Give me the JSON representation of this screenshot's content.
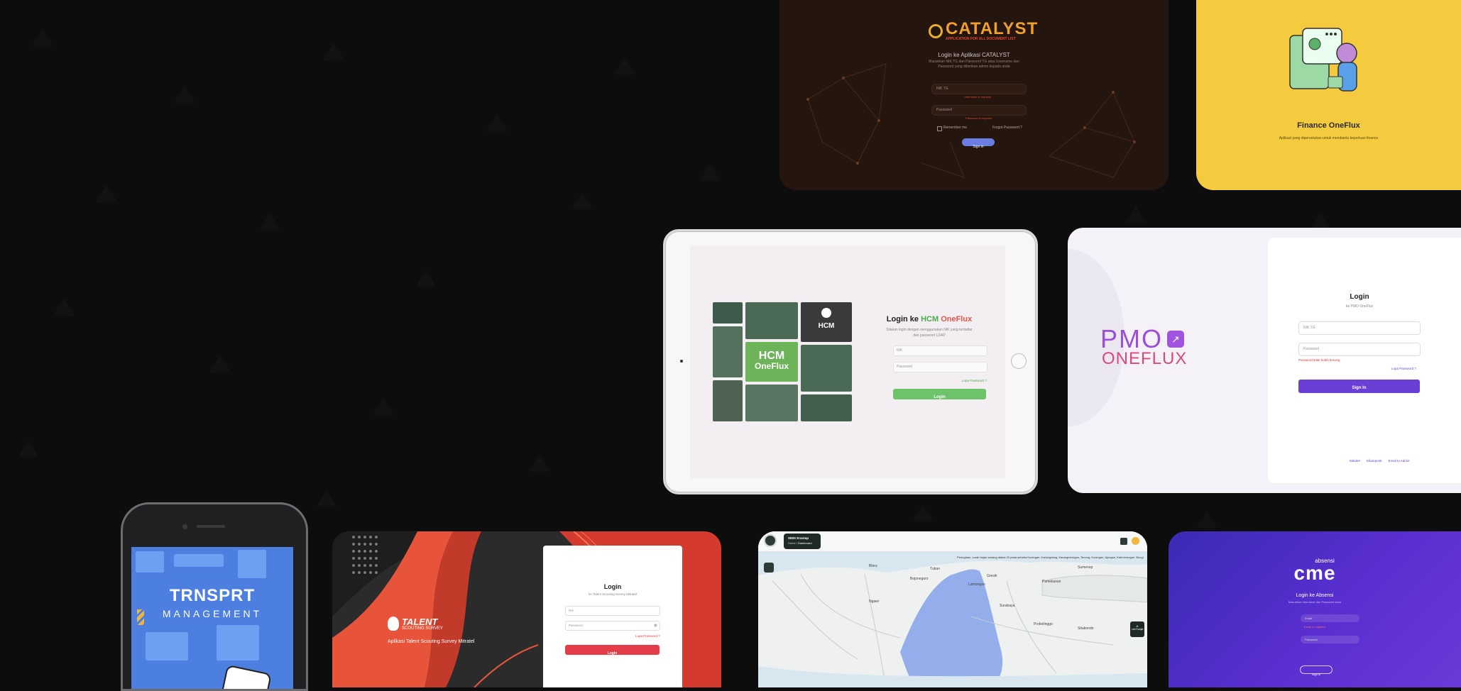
{
  "catalyst": {
    "logo_name": "CATALYST",
    "logo_tagline": "APPLICATION FOR ALL DOCUMENT LIST",
    "heading": "Login ke Aplikasi CATALYST",
    "subtitle_1": "Masukkan NIK TG dan Password TG atau Username dan",
    "subtitle_2": "Password yang diberikan admin kepada anda",
    "nik_placeholder": "NIK TG",
    "nik_error": "Username is required",
    "password_placeholder": "Password",
    "password_error": "Password is required",
    "remember": "Remember me",
    "forgot": "Forgot Password ?",
    "signin": "Sign in"
  },
  "finance": {
    "title": "Finance OneFlux",
    "subtitle": "Aplikasi yang diperuntukan untuk membantu keperluan finance"
  },
  "hcm": {
    "heading_prefix": "Login ke ",
    "heading_hcm": "HCM",
    "heading_oneflux": " OneFlux",
    "subtitle_1": "Silakan login dengan menggunakan NIK yang terdaftar",
    "subtitle_2": "dan password LDAP",
    "nik_placeholder": "NIK",
    "password_placeholder": "Password",
    "forgot": "Lupa Password ?",
    "login": "Login",
    "tile_logo_1": "HCM",
    "tile_logo_2": "OneFlux",
    "tile_hcm": "HCM"
  },
  "pmo": {
    "logo_pmo": "PMO",
    "logo_oneflux": "ONEFLUX",
    "heading": "Login",
    "subheading": "ke PMO OneFlux",
    "nik_placeholder": "NIK TG",
    "password_placeholder": "Password",
    "password_error": "Password tidak boleh kosong",
    "forgot": "Lupa Password ?",
    "signin": "Sign In",
    "footer_links": [
      "Mitratel",
      "Sharepoint",
      "Email to Admin"
    ]
  },
  "transport": {
    "title": "TRNSPRT",
    "subtitle": "MANAGEMENT"
  },
  "talent": {
    "brand_1": "TALENT",
    "brand_2": "SCOUTING SURVEY",
    "tagline": "Aplikasi Talent Scouting Survey Mitratel",
    "heading": "Login",
    "subheading": "ke Talent Scouting Survey Mitratel",
    "nik_placeholder": "NIK",
    "password_placeholder": "Password",
    "forgot": "Lupa Password ?",
    "login": "Login"
  },
  "map": {
    "app_name": "SIMS Erantap",
    "breadcrumb_home": "Home",
    "breadcrumb_sep": "/",
    "breadcrumb_page": "Dashboard",
    "ticker": "Peringatan, curah hujan sedang diatas 20 pada sebaba Kuningan, Kadongrlang, Karangbenngan, Tenong, Kuningan, Ajungan, Kabmemngan, Bungi",
    "place_labels": [
      "Blora",
      "Bojonegoro",
      "Tuban",
      "Lamongan",
      "Gresik",
      "Sumenep",
      "Pamekasan",
      "Ngawi",
      "Probolinggo",
      "Situbondo",
      "Surabaya"
    ],
    "panel_label_1": "JL",
    "panel_label_2": "Lab Kanjal"
  },
  "absensi": {
    "logo_small": "absensi",
    "logo_big": "cme",
    "heading": "Login ke Absensi",
    "subtitle": "Masukkan Username dan Password anda",
    "email_placeholder": "Email",
    "email_error": "Email is required",
    "password_placeholder": "Password",
    "signin": "Sign in"
  },
  "colors": {
    "background": "#0d0d0e",
    "catalyst_bg": "#24150f",
    "finance_bg": "#f4cb3f",
    "hcm_green": "#6cc36a",
    "pmo_purple": "#6a3fd6",
    "talent_red": "#e23d48",
    "absensi_purple": "#4a2bc4"
  }
}
